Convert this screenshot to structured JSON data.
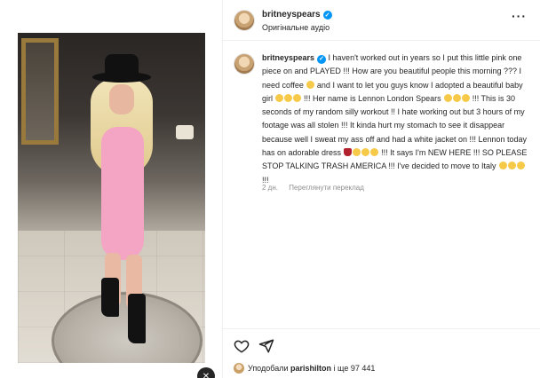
{
  "post": {
    "username": "britneyspears",
    "audio": "Оригінальне аудіо",
    "caption": {
      "seg1": "I haven't worked out in years so I put this little pink one piece on and PLAYED !!! How are you beautiful people this morning ??? I need coffee",
      "seg2": "and I want to let you guys know I adopted a beautiful baby girl",
      "seg3": "!!! Her name is Lennon London Spears",
      "seg4": "!!! This is 30 seconds of my random silly workout !! I hate working out but 3 hours of my footage was all stolen !!! It kinda hurt my stomach to see it disappear because well I sweat my ass off and had a white jacket on !!!  Lennon today has on adorable dress",
      "seg5": "!!! It says I'm NEW HERE !!! SO PLEASE STOP TALKING TRASH AMERICA !!! I've decided to move to Italy",
      "seg6": "!!!"
    },
    "time": "2 дн.",
    "translate": "Переглянути переклад",
    "likes": {
      "prefix": "Уподобали",
      "user": "parishilton",
      "suffix": "і ще 97 441"
    }
  },
  "icons": {
    "more": "more-options-icon",
    "like": "heart-icon",
    "share": "share-icon",
    "mute": "mute-icon"
  },
  "colors": {
    "verified": "#0095f6",
    "text": "#262626",
    "secondary": "#8e8e8e",
    "swimsuit": "#f3a5c3"
  }
}
